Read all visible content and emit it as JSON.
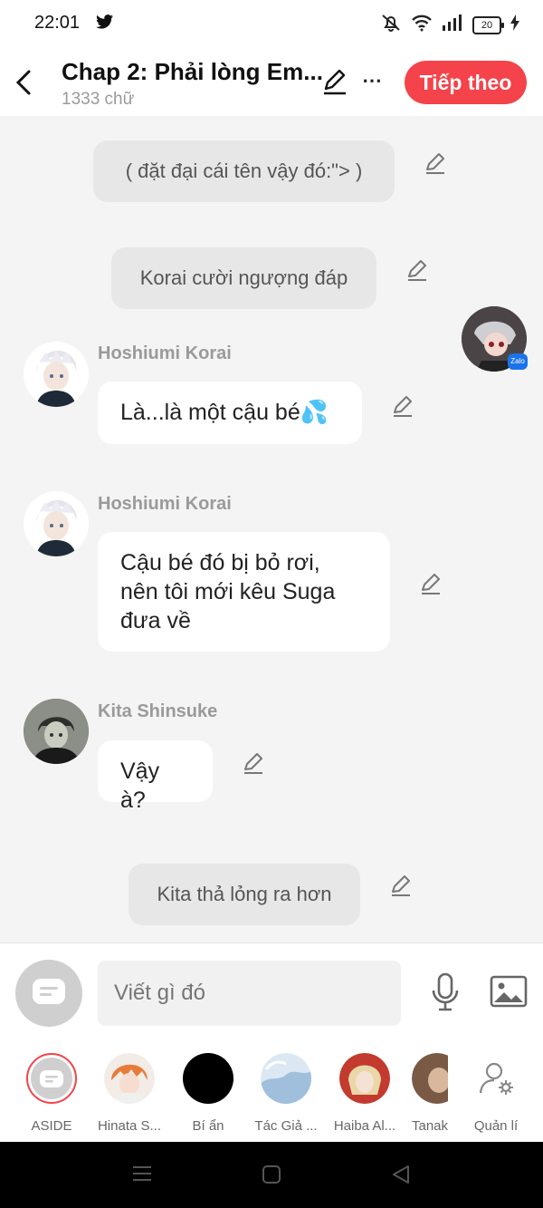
{
  "status": {
    "time": "22:01",
    "battery": "20"
  },
  "header": {
    "title": "Chap 2: Phải lòng Em...",
    "subtitle": "1333 chữ",
    "next_label": "Tiếp theo"
  },
  "messages": {
    "narr1": "( đặt đại cái tên vậy đó:\"> )",
    "narr2": "Korai cười ngượng đáp",
    "m1": {
      "name": "Hoshiumi Korai",
      "text": "Là...là một cậu bé💦"
    },
    "m2": {
      "name": "Hoshiumi Korai",
      "line1": "Cậu bé đó bị bỏ rơi,",
      "line2": "nên tôi mới kêu Suga",
      "line3": "đưa về"
    },
    "m3": {
      "name": "Kita Shinsuke",
      "text": "Vậy à?"
    },
    "narr3": "Kita thả lỏng ra hơn"
  },
  "composer": {
    "placeholder": "Viết gì đó"
  },
  "characters": [
    {
      "label": "ASIDE"
    },
    {
      "label": "Hinata S..."
    },
    {
      "label": "Bí ẩn"
    },
    {
      "label": "Tác Giả ..."
    },
    {
      "label": "Haiba Al..."
    },
    {
      "label": "Tanak"
    },
    {
      "label": "Quản lí"
    }
  ],
  "icons": {
    "accent": "#f4434a"
  }
}
